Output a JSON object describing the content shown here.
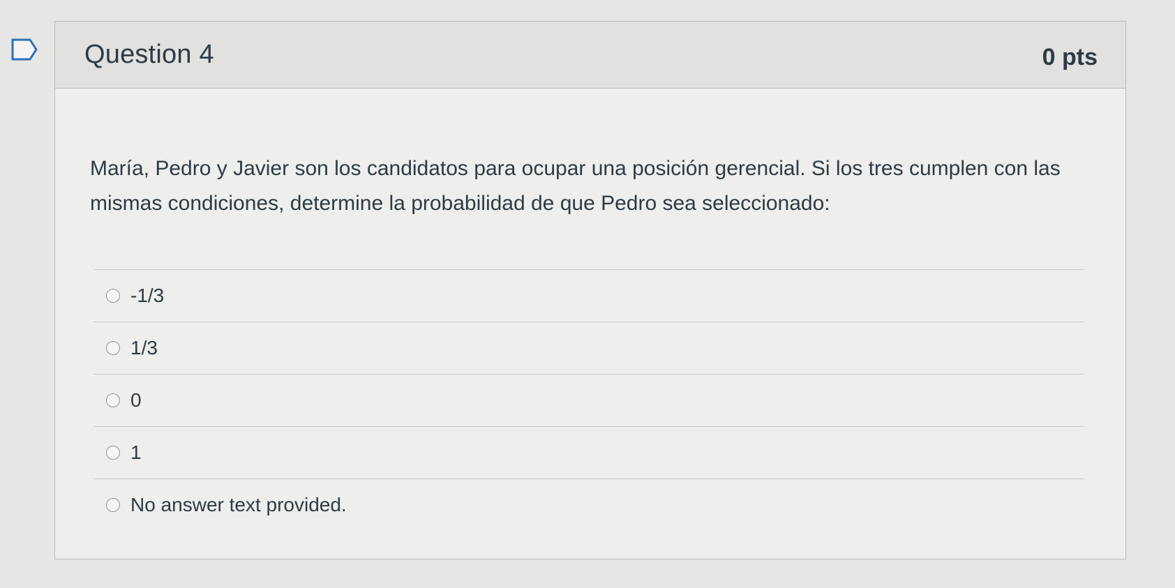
{
  "question": {
    "title": "Question 4",
    "points": "0 pts",
    "text": "María, Pedro y Javier son los candidatos para ocupar una posición gerencial. Si los tres cumplen con las mismas condiciones, determine la probabilidad de que Pedro sea seleccionado:",
    "answers": [
      {
        "label": "-1/3"
      },
      {
        "label": "1/3"
      },
      {
        "label": "0"
      },
      {
        "label": "1"
      },
      {
        "label": "No answer text provided."
      }
    ]
  }
}
